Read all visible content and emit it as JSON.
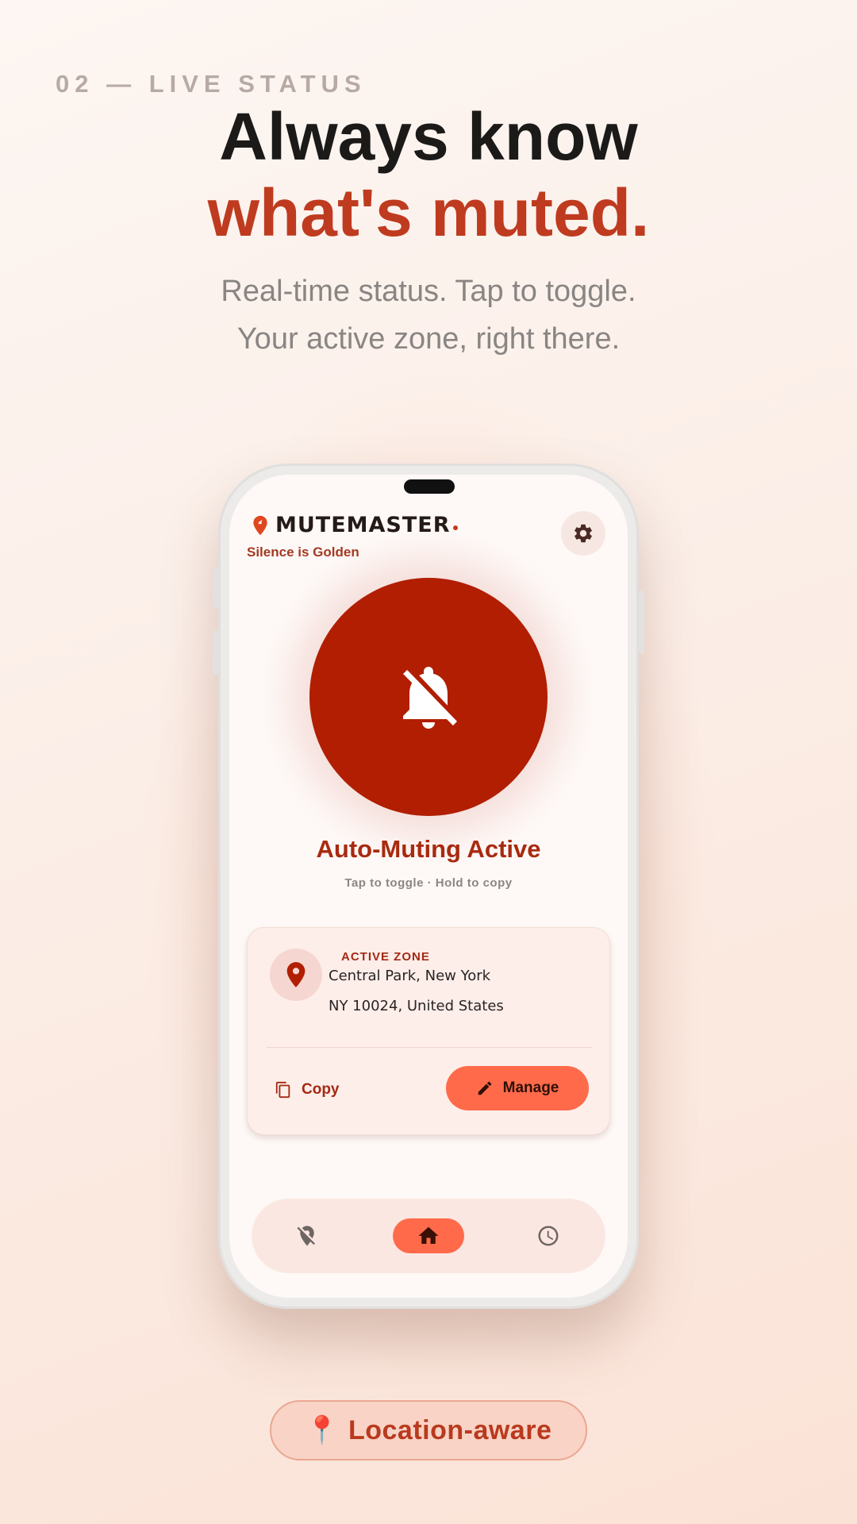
{
  "eyebrow": "02 — LIVE STATUS",
  "headline": {
    "line1": "Always know",
    "line2": "what's muted."
  },
  "subtitle": {
    "line1": "Real-time status. Tap to toggle.",
    "line2": "Your active zone, right there."
  },
  "app": {
    "name": "MUTEMASTER",
    "tagline": "Silence is Golden",
    "settings_icon": "gear-icon",
    "mute_button": {
      "icon": "bell-off-icon",
      "status": "Auto-Muting Active",
      "hint": "Tap to toggle · Hold to copy"
    },
    "zone_card": {
      "label": "ACTIVE ZONE",
      "address_line1": "Central Park, New York",
      "address_line2": "NY 10024, United States",
      "copy_label": "Copy",
      "manage_label": "Manage"
    },
    "bottom_nav": [
      {
        "name": "zones",
        "icon": "location-off-icon",
        "active": false
      },
      {
        "name": "home",
        "icon": "home-icon",
        "active": true
      },
      {
        "name": "history",
        "icon": "clock-icon",
        "active": false
      }
    ]
  },
  "badge": {
    "icon": "📍",
    "label": "Location-aware"
  },
  "colors": {
    "accent": "#bf3b1f",
    "mute_button": "#b11e02",
    "action": "#ff6a4a"
  }
}
